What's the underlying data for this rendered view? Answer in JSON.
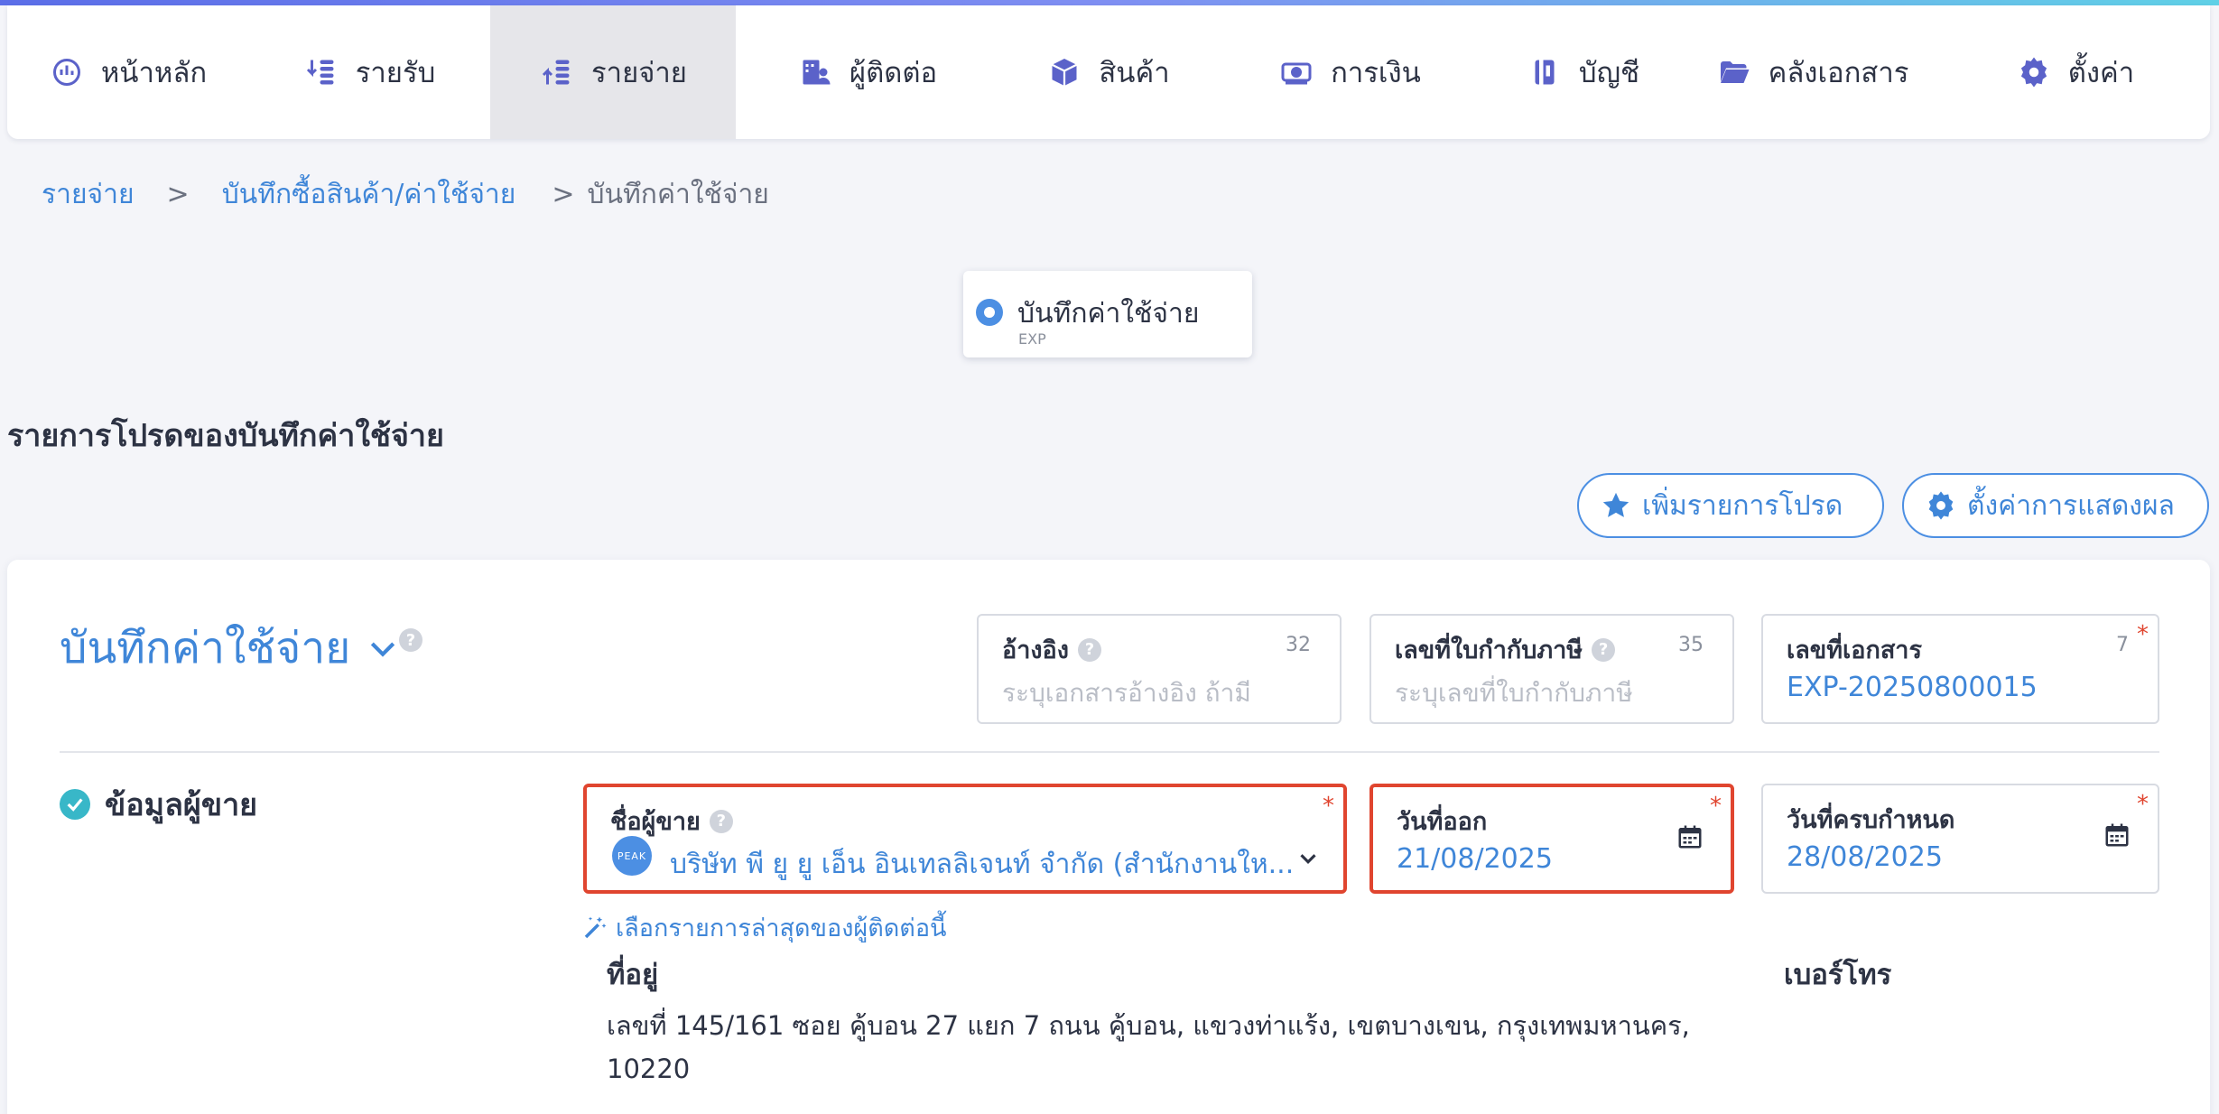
{
  "nav": {
    "items": [
      {
        "label": "หน้าหลัก",
        "icon": "dashboard-icon"
      },
      {
        "label": "รายรับ",
        "icon": "income-icon"
      },
      {
        "label": "รายจ่าย",
        "icon": "expense-icon",
        "active": true
      },
      {
        "label": "ผู้ติดต่อ",
        "icon": "contacts-icon"
      },
      {
        "label": "สินค้า",
        "icon": "box-icon"
      },
      {
        "label": "การเงิน",
        "icon": "money-icon"
      },
      {
        "label": "บัญชี",
        "icon": "accounting-icon"
      },
      {
        "label": "คลังเอกสาร",
        "icon": "folder-icon"
      },
      {
        "label": "ตั้งค่า",
        "icon": "gear-icon"
      }
    ]
  },
  "breadcrumb": {
    "items": [
      "รายจ่าย",
      "บันทึกซื้อสินค้า/ค่าใช้จ่าย",
      "บันทึกค่าใช้จ่าย"
    ],
    "separator": ">"
  },
  "doc_type": {
    "title": "บันทึกค่าใช้จ่าย",
    "code": "EXP"
  },
  "favorites": {
    "title": "รายการโปรดของบันทึกค่าใช้จ่าย",
    "add_label": "เพิ่มรายการโปรด",
    "settings_label": "ตั้งค่าการแสดงผล"
  },
  "form": {
    "title": "บันทึกค่าใช้จ่าย",
    "help": "?",
    "reference": {
      "label": "อ้างอิง",
      "count": "32",
      "placeholder": "ระบุเอกสารอ้างอิง ถ้ามี"
    },
    "tax_invoice": {
      "label": "เลขที่ใบกำกับภาษี",
      "count": "35",
      "placeholder": "ระบุเลขที่ใบกำกับภาษี"
    },
    "doc_number": {
      "label": "เลขที่เอกสาร",
      "count": "7",
      "value": "EXP-20250800015"
    },
    "required_mark": "*",
    "vendor_section": {
      "title": "ข้อมูลผู้ขาย",
      "vendor": {
        "label": "ชื่อผู้ขาย",
        "logo_text": "PEAK",
        "value": "บริษัท พี ยู ยู เอ็น อินเทลลิเจนท์ จำกัด (สำนักงานให..."
      },
      "issue_date": {
        "label": "วันที่ออก",
        "value": "21/08/2025"
      },
      "due_date": {
        "label": "วันที่ครบกำหนด",
        "value": "28/08/2025"
      },
      "latest_link": "เลือกรายการล่าสุดของผู้ติดต่อนี้",
      "address_label": "ที่อยู่",
      "phone_label": "เบอร์โทร",
      "address": "เลขที่ 145/161 ซอย คู้บอน 27 แยก 7 ถนน คู้บอน, แขวงท่าแร้ง, เขตบางเขน, กรุงเทพมหานคร, 10220"
    }
  },
  "colors": {
    "accent": "#3f86d8",
    "highlight": "#e0452f",
    "nav_active": "#e6e6ea",
    "check": "#38b7c8"
  }
}
